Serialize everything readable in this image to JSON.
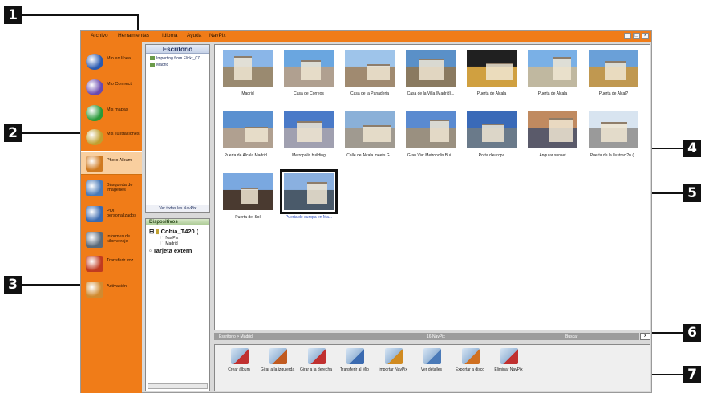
{
  "callouts": [
    "1",
    "2",
    "3",
    "4",
    "5",
    "6",
    "7"
  ],
  "menu": [
    "Archivo",
    "Herramientas",
    "Idioma",
    "Ayuda",
    "NavPix"
  ],
  "window_controls": [
    "_",
    "□",
    "×"
  ],
  "nav": [
    {
      "label": "Mio en línea",
      "icon": "globe-icon",
      "color": "#2a5ab0"
    },
    {
      "label": "Mio Connect",
      "icon": "connect-icon",
      "color": "#6a4ab0"
    },
    {
      "label": "Mis mapas",
      "icon": "map-icon",
      "color": "#2a9a3a"
    },
    {
      "label": "Mis ilustraciones",
      "icon": "illustrations-icon",
      "color": "#c0a030"
    },
    {
      "label": "Photo Album",
      "icon": "photo-album-icon",
      "color": "#d07a20"
    },
    {
      "label": "Búsqueda de imágenes",
      "icon": "image-search-icon",
      "color": "#4a7ab8"
    },
    {
      "label": "POI personalizados",
      "icon": "poi-icon",
      "color": "#3a6ab0"
    },
    {
      "label": "Informes de kilometraje",
      "icon": "mileage-report-icon",
      "color": "#5a6a7a"
    },
    {
      "label": "Transferir voz",
      "icon": "voice-transfer-icon",
      "color": "#c03a20"
    },
    {
      "label": "Activación",
      "icon": "activation-icon",
      "color": "#d08a30"
    }
  ],
  "desktop_panel": {
    "title": "Escritorio",
    "items": [
      "Importing from Flickr_07",
      "Madrid"
    ],
    "footer": "Ver todas las NavPix"
  },
  "devices_panel": {
    "title": "Dispositivos",
    "device": "Cobia_T420 (",
    "subitems": [
      "NavPix",
      "Madrid"
    ],
    "card": "Tarjeta extern"
  },
  "gallery": [
    {
      "caption": "Madrid",
      "sky": "#8ab6e8",
      "ground": "#9a8a70"
    },
    {
      "caption": "Casa de Correos",
      "sky": "#6aa6e0",
      "ground": "#b0a090"
    },
    {
      "caption": "Casa de la Panaderia",
      "sky": "#9ec4ea",
      "ground": "#a08a70"
    },
    {
      "caption": "Casa de la Villa (Madrid)...",
      "sky": "#5a90c8",
      "ground": "#8a7a60"
    },
    {
      "caption": "Puerta de Alcala",
      "sky": "#202020",
      "ground": "#d0a040"
    },
    {
      "caption": "Puerta de Alcala",
      "sky": "#7ab0e6",
      "ground": "#c0b8a0"
    },
    {
      "caption": "Puerta de Alcal?",
      "sky": "#6aa0d8",
      "ground": "#c09850"
    },
    {
      "caption": "Puerta de Alcala Madrid ...",
      "sky": "#5a90d0",
      "ground": "#b0a090"
    },
    {
      "caption": "Metropolis building",
      "sky": "#4a7ac8",
      "ground": "#a0a0b0"
    },
    {
      "caption": "Calle de Alcala meets G...",
      "sky": "#8ab0d8",
      "ground": "#a09a90"
    },
    {
      "caption": "Gran Via: Metropolis Bui...",
      "sky": "#5a8ad0",
      "ground": "#9a9080"
    },
    {
      "caption": "Porta d'europa",
      "sky": "#3a6ab8",
      "ground": "#6a7a8a"
    },
    {
      "caption": "Angular sunset",
      "sky": "#c08a60",
      "ground": "#5a5a6a"
    },
    {
      "caption": "Puerta de la Ilustraci?n (...",
      "sky": "#d8e4f0",
      "ground": "#9a9a9a"
    },
    {
      "caption": "Puerta del Sol",
      "sky": "#7aa8e0",
      "ground": "#4a3a30"
    },
    {
      "caption": "Puerta de europa en Ma...",
      "sky": "#8ab0e0",
      "ground": "#4a5a6a",
      "selected": true
    }
  ],
  "status": {
    "path": "Escritorio > Madrid",
    "count": "16 NavPix",
    "search": "Buscar",
    "box": "x"
  },
  "toolbar": [
    {
      "label": "Crear álbum",
      "icon": "create-album-icon"
    },
    {
      "label": "Girar a la izquierda",
      "icon": "rotate-left-icon"
    },
    {
      "label": "Girar a la derecha",
      "icon": "rotate-right-icon"
    },
    {
      "label": "Transferir al Mio",
      "icon": "transfer-to-mio-icon"
    },
    {
      "label": "Importar NavPix",
      "icon": "import-navpix-icon"
    },
    {
      "label": "Ver detalles",
      "icon": "view-details-icon"
    },
    {
      "label": "Exportar a disco",
      "icon": "export-to-disk-icon"
    },
    {
      "label": "Eliminar NavPix",
      "icon": "delete-navpix-icon"
    }
  ]
}
